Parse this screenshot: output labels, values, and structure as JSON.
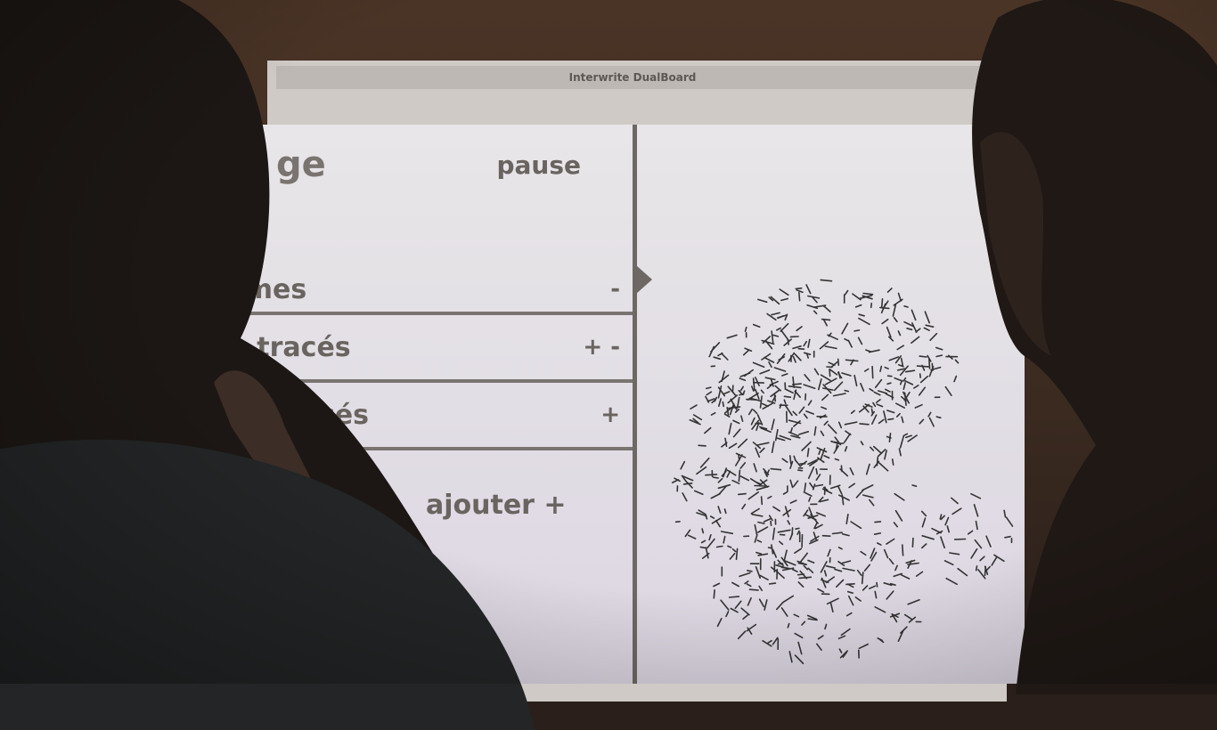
{
  "board": {
    "brand_label": "Interwrite DualBoard"
  },
  "panel": {
    "title_fragment": "ge",
    "pause_label": "pause",
    "rows": [
      {
        "label": "rmes",
        "controls": "-"
      },
      {
        "label": "s tracés",
        "controls": "+ -"
      },
      {
        "label": "es tracés",
        "controls": "+"
      }
    ],
    "add_label": "ajouter +"
  },
  "colors": {
    "ui_text": "#6a6460",
    "divider": "#6e6864",
    "projection_bg": "#e8e6e8"
  }
}
